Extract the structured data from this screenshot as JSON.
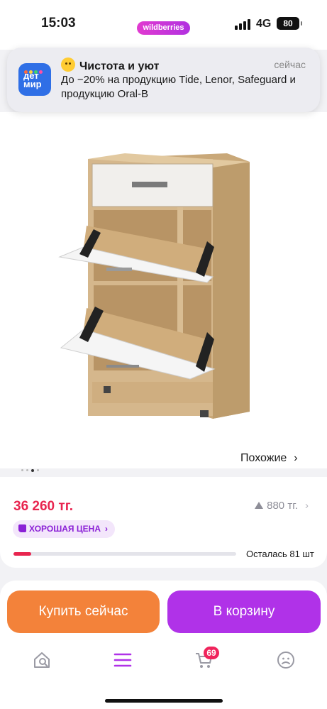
{
  "status_bar": {
    "time": "15:03",
    "carrier_pill": "wildberries",
    "network": "4G",
    "battery": "80"
  },
  "notification": {
    "app_icon_text": "дет\nмир",
    "title": "Чистота и уют",
    "time": "сейчас",
    "body": "До −20% на продукцию Tide, Lenor, Safeguard и продукцию Oral-B"
  },
  "product": {
    "gallery": {
      "count": 4,
      "active_index": 2
    },
    "similar_label": "Похожие",
    "price": "36 260 тг.",
    "points": "880 тг.",
    "badge": "ХОРОШАЯ ЦЕНА",
    "stock_text": "Осталась 81 шт",
    "stock_fraction": 0.08
  },
  "actions": {
    "buy_now": "Купить сейчас",
    "add_to_cart": "В корзину"
  },
  "tab_bar": {
    "cart_count": "69",
    "active_tab": "catalog"
  },
  "colors": {
    "price": "#e8254f",
    "buy_now": "#f3823a",
    "add_to_cart": "#b032e8",
    "badge_text": "#8a1fd6",
    "cart_badge": "#f0245c"
  },
  "icons": [
    "signal-icon",
    "battery-icon",
    "chevron-right-icon",
    "thumbs-up-icon",
    "home-icon",
    "catalog-icon",
    "cart-icon",
    "profile-icon"
  ]
}
